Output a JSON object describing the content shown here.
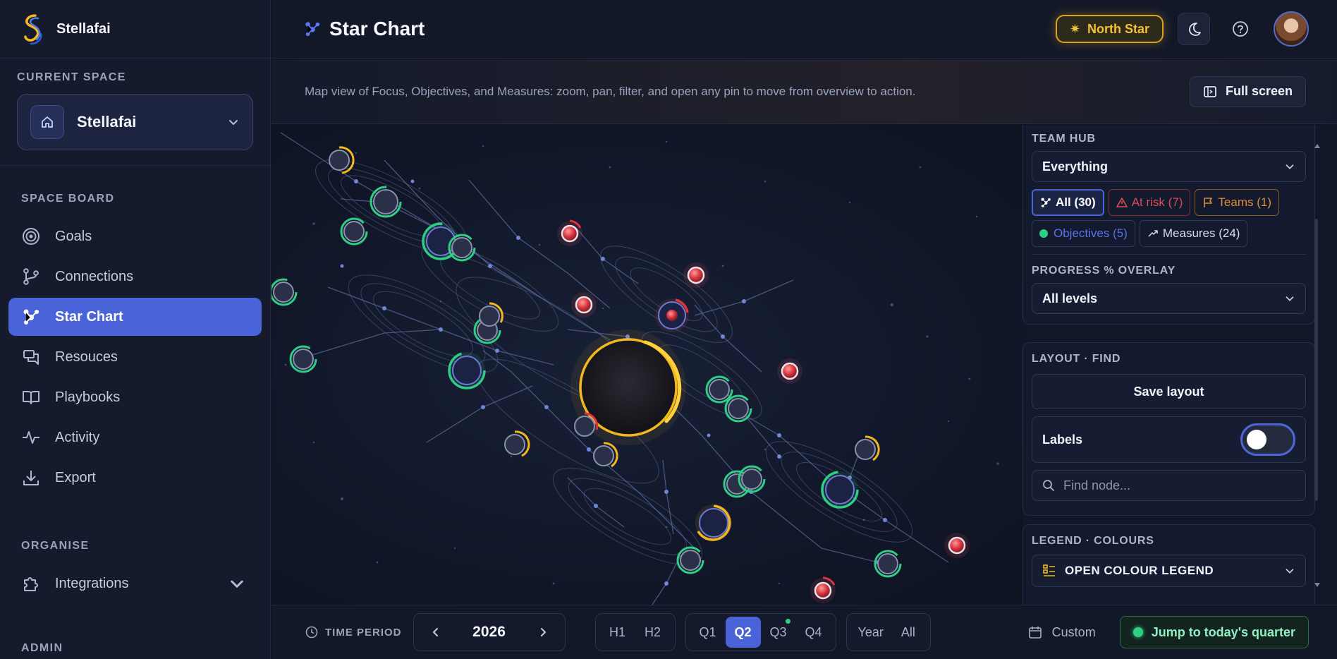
{
  "brand": {
    "name": "Stellafai"
  },
  "space": {
    "label": "CURRENT SPACE",
    "name": "Stellafai"
  },
  "nav": {
    "section_label": "SPACE BOARD",
    "items": [
      {
        "label": "Goals",
        "icon": "target-icon"
      },
      {
        "label": "Connections",
        "icon": "git-branch-icon"
      },
      {
        "label": "Star Chart",
        "icon": "constellation-icon",
        "active": true
      },
      {
        "label": "Resouces",
        "icon": "chat-icon"
      },
      {
        "label": "Playbooks",
        "icon": "book-icon"
      },
      {
        "label": "Activity",
        "icon": "pulse-icon"
      },
      {
        "label": "Export",
        "icon": "download-icon"
      }
    ],
    "organise_label": "ORGANISE",
    "integrations_label": "Integrations",
    "admin_label": "ADMIN"
  },
  "header": {
    "title": "Star Chart",
    "north_star_label": "North Star"
  },
  "subheader": {
    "description": "Map view of Focus, Objectives, and Measures: zoom, pan, filter, and open any pin to move from overview to action.",
    "fullscreen_label": "Full screen"
  },
  "panel": {
    "team_hub_label": "TEAM HUB",
    "team_hub_value": "Everything",
    "filters": {
      "all": "All (30)",
      "at_risk": "At risk (7)",
      "teams": "Teams (1)",
      "objectives": "Objectives (5)",
      "measures": "Measures (24)"
    },
    "progress_label": "PROGRESS % OVERLAY",
    "progress_value": "All levels",
    "layout_label": "LAYOUT · FIND",
    "save_layout": "Save layout",
    "labels_toggle": "Labels",
    "find_placeholder": "Find node...",
    "legend_label": "LEGEND · COLOURS",
    "legend_button": "OPEN COLOUR LEGEND"
  },
  "footer": {
    "time_period_label": "TIME PERIOD",
    "year": "2026",
    "halves": [
      "H1",
      "H2"
    ],
    "quarters": [
      "Q1",
      "Q2",
      "Q3",
      "Q4"
    ],
    "active_quarter": "Q2",
    "ranges": [
      "Year",
      "All"
    ],
    "custom_label": "Custom",
    "jump_label": "Jump to today's quarter"
  },
  "colors": {
    "accent": "#4a63d8",
    "north_star": "#f2c232",
    "objective": "#2fce86",
    "at_risk": "#e04b56",
    "teams": "#e08c3a"
  }
}
